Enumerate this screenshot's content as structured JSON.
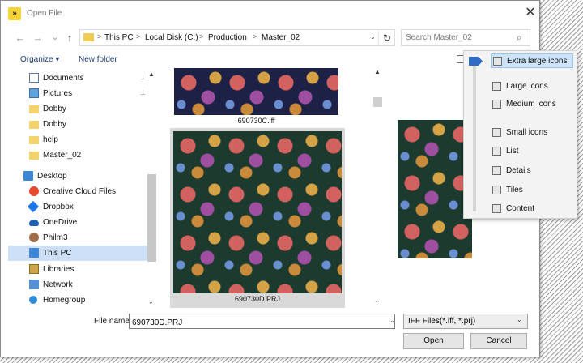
{
  "window": {
    "title": "Open File",
    "close_glyph": "✕"
  },
  "nav_buttons": {
    "back": "←",
    "forward": "→",
    "recent": "⌄",
    "up": "↑"
  },
  "breadcrumb": {
    "items": [
      "This PC",
      "Local Disk (C:)",
      "Production",
      "Master_02"
    ],
    "separator": ">",
    "overflow": "«",
    "refresh_glyph": "↻"
  },
  "search": {
    "placeholder": "Search Master_02",
    "icon_glyph": "⌕"
  },
  "toolbar": {
    "organize": "Organize ▾",
    "new_folder": "New folder"
  },
  "sidebar": {
    "items": [
      {
        "label": "Documents",
        "icon": "documents-icon",
        "pinned": true
      },
      {
        "label": "Pictures",
        "icon": "pictures-icon",
        "pinned": true
      },
      {
        "label": "Dobby",
        "icon": "folder-icon"
      },
      {
        "label": "Dobby",
        "icon": "folder-icon"
      },
      {
        "label": "help",
        "icon": "folder-icon"
      },
      {
        "label": "Master_02",
        "icon": "folder-icon"
      },
      {
        "label": "Desktop",
        "icon": "desktop-icon"
      },
      {
        "label": "Creative Cloud Files",
        "icon": "creative-cloud-icon"
      },
      {
        "label": "Dropbox",
        "icon": "dropbox-icon"
      },
      {
        "label": "OneDrive",
        "icon": "onedrive-icon"
      },
      {
        "label": "Philm3",
        "icon": "user-icon"
      },
      {
        "label": "This PC",
        "icon": "this-pc-icon",
        "selected": true
      },
      {
        "label": "Libraries",
        "icon": "libraries-icon"
      },
      {
        "label": "Network",
        "icon": "network-icon"
      },
      {
        "label": "Homegroup",
        "icon": "homegroup-icon"
      }
    ],
    "pin_glyph": "📌",
    "arrow_up": "▲",
    "arrow_down": "⌄"
  },
  "files": [
    {
      "name": "690730C.iff"
    },
    {
      "name": "690730D.PRJ",
      "selected": true
    }
  ],
  "view_menu": {
    "items": [
      {
        "label": "Extra large icons",
        "selected": true
      },
      {
        "label": "Large icons"
      },
      {
        "label": "Medium icons"
      },
      {
        "label": "Small icons"
      },
      {
        "label": "List"
      },
      {
        "label": "Details"
      },
      {
        "label": "Tiles"
      },
      {
        "label": "Content"
      }
    ]
  },
  "footer": {
    "file_name_label": "File name:",
    "file_name_value": "690730D.PRJ",
    "file_type": "IFF Files(*.iff, *.prj)",
    "open_button": "Open",
    "cancel_button": "Cancel",
    "caret": "⌄"
  },
  "colors": {
    "accent": "#2e6cc5",
    "selection": "#cde0f7",
    "folder": "#f4d36b"
  }
}
